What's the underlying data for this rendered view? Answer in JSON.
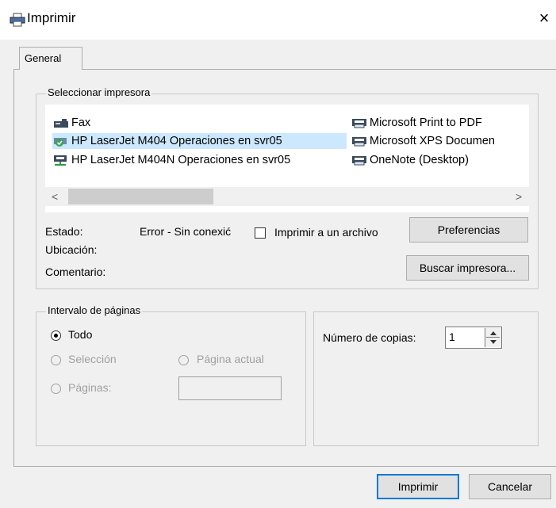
{
  "window": {
    "title": "Imprimir",
    "close_symbol": "×"
  },
  "tabs": [
    {
      "label": "General"
    }
  ],
  "printer_group": {
    "label": "Seleccionar impresora",
    "printers_col1": [
      {
        "name": "Fax",
        "icon": "fax-printer-icon",
        "selected": false
      },
      {
        "name": "HP LaserJet M404 Operaciones en svr05",
        "icon": "default-printer-icon",
        "selected": true
      },
      {
        "name": "HP LaserJet M404N Operaciones en svr05",
        "icon": "network-printer-icon",
        "selected": false
      }
    ],
    "printers_col2": [
      {
        "name": "Microsoft Print to PDF",
        "icon": "printer-icon"
      },
      {
        "name": "Microsoft XPS Documen",
        "icon": "printer-icon"
      },
      {
        "name": "OneNote (Desktop)",
        "icon": "printer-icon"
      }
    ],
    "scroll_left": "<",
    "scroll_right": ">",
    "status_label": "Estado:",
    "status_value": "Error - Sin conexić",
    "location_label": "Ubicación:",
    "comment_label": "Comentario:",
    "print_to_file_label": "Imprimir a un archivo",
    "print_to_file_checked": false,
    "preferences_button": "Preferencias",
    "find_printer_button": "Buscar impresora..."
  },
  "page_range": {
    "label": "Intervalo de páginas",
    "all": "Todo",
    "selection": "Selección",
    "current_page": "Página actual",
    "pages": "Páginas:",
    "pages_value": "",
    "selected_option": "all"
  },
  "copies": {
    "label": "Número de copias:",
    "value": "1"
  },
  "footer": {
    "print_button": "Imprimir",
    "cancel_button": "Cancelar"
  },
  "colors": {
    "accent": "#0078d7",
    "selection": "#cce8ff",
    "disabled_text": "#a0a0a0"
  }
}
